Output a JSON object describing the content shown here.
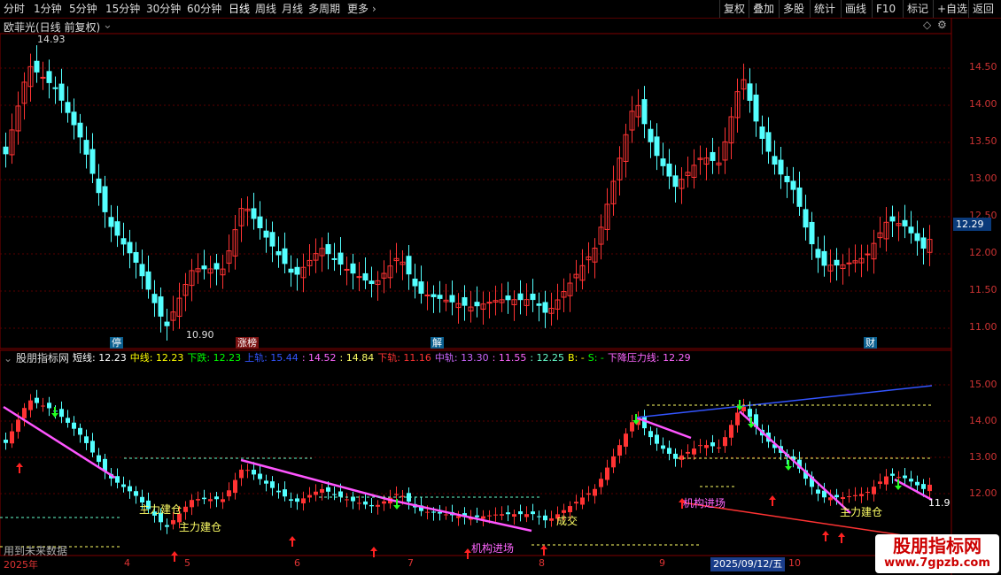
{
  "toolbar": {
    "periods": [
      "分时",
      "1分钟",
      "5分钟",
      "15分钟",
      "30分钟",
      "60分钟",
      "日线",
      "周线",
      "月线",
      "多周期",
      "更多"
    ],
    "active_period": "日线",
    "right_buttons": [
      "复权",
      "叠加",
      "多股",
      "统计",
      "画线",
      "F10",
      "标记",
      "+自选",
      "返回"
    ]
  },
  "main": {
    "title": "欧菲光(日线 前复权)",
    "max_label": "14.93",
    "min_label": "10.90",
    "price_axis": [
      "14.50",
      "14.00",
      "13.50",
      "13.00",
      "12.50",
      "12.00",
      "11.50",
      "11.00"
    ],
    "current_price": "12.29",
    "events": [
      {
        "label": "停",
        "color": "#0a5f8f"
      },
      {
        "label": "涨榜",
        "color": "#7a1111"
      },
      {
        "label": "解",
        "color": "#0a5f8f"
      },
      {
        "label": "财",
        "color": "#0a5f8f"
      }
    ]
  },
  "indicator": {
    "name": "股朋指标网",
    "items": [
      {
        "text": "短线: 12.23",
        "color": "#ffffff"
      },
      {
        "text": "中线: 12.23",
        "color": "#ffff00"
      },
      {
        "text": "下跌: 12.23",
        "color": "#00ff00"
      },
      {
        "text": "上轨: 15.44",
        "color": "#3355ff"
      },
      {
        "text": ": 14.52",
        "color": "#ff66ff"
      },
      {
        "text": ": 14.84",
        "color": "#ffff66"
      },
      {
        "text": "下轨: 11.16",
        "color": "#ff3333"
      },
      {
        "text": "中轨: 13.30",
        "color": "#cc66ff"
      },
      {
        "text": ": 11.55",
        "color": "#ff66ff"
      },
      {
        "text": ": 12.25",
        "color": "#66ffcc"
      },
      {
        "text": "B: -",
        "color": "#ffff00"
      },
      {
        "text": "S: -",
        "color": "#00ff00"
      },
      {
        "text": "下降压力线: 12.29",
        "color": "#ff66ff"
      }
    ],
    "axis": [
      "15.00",
      "14.00",
      "13.00",
      "12.00"
    ],
    "last_value": "11.9",
    "annotations": {
      "build1": "主力建仓",
      "build2": "主力建仓",
      "build3": "主力建仓",
      "inst1": "机构进场",
      "inst2": "机构进场",
      "volume": "成交"
    },
    "future_note": "用到未来数据"
  },
  "x_axis": {
    "labels": [
      "2025年",
      "4",
      "5",
      "6",
      "7",
      "8",
      "9",
      "10"
    ],
    "cursor_date": "2025/09/12/五"
  },
  "watermark": {
    "title": "股朋指标网",
    "url": "www.7gpzb.com"
  }
}
